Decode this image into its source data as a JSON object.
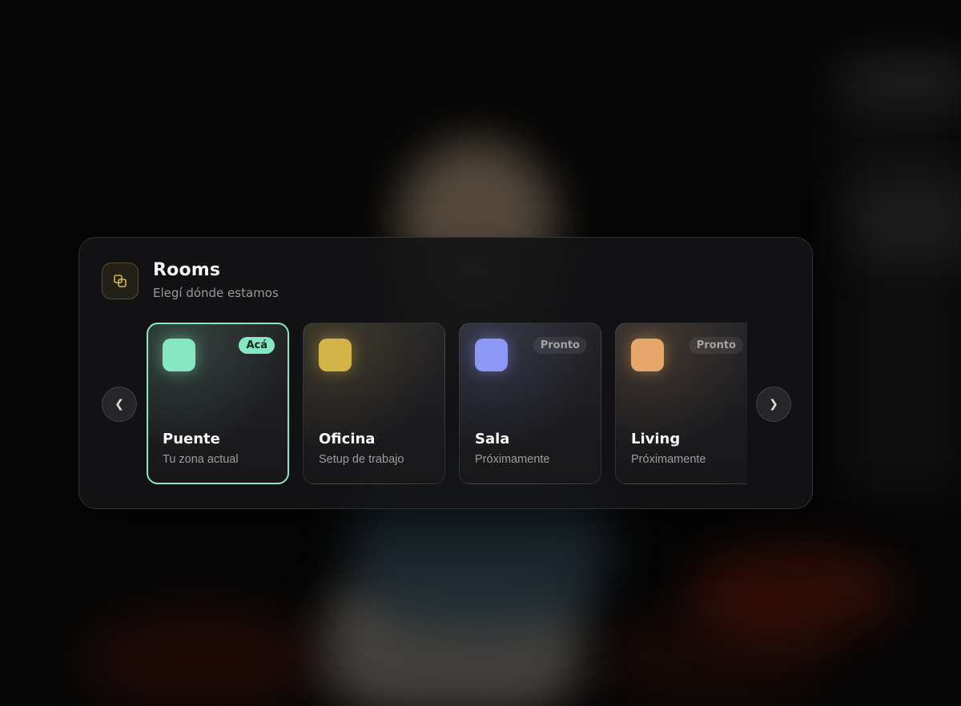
{
  "panel": {
    "title": "Rooms",
    "subtitle": "Elegí dónde estamos",
    "header_icon": "layers-icon",
    "accent": "#d4b54a"
  },
  "navigation": {
    "prev_label": "❮",
    "next_label": "❯"
  },
  "rooms": [
    {
      "name": "Puente",
      "description": "Tu zona actual",
      "badge": "Acá",
      "status": "current",
      "color": "#86e8c3"
    },
    {
      "name": "Oficina",
      "description": "Setup de trabajo",
      "badge": "",
      "status": "available",
      "color": "#d3b448"
    },
    {
      "name": "Sala",
      "description": "Próximamente",
      "badge": "Pronto",
      "status": "coming-soon",
      "color": "#8c98f5"
    },
    {
      "name": "Living",
      "description": "Próximamente",
      "badge": "Pronto",
      "status": "coming-soon",
      "color": "#e6a76a"
    }
  ]
}
